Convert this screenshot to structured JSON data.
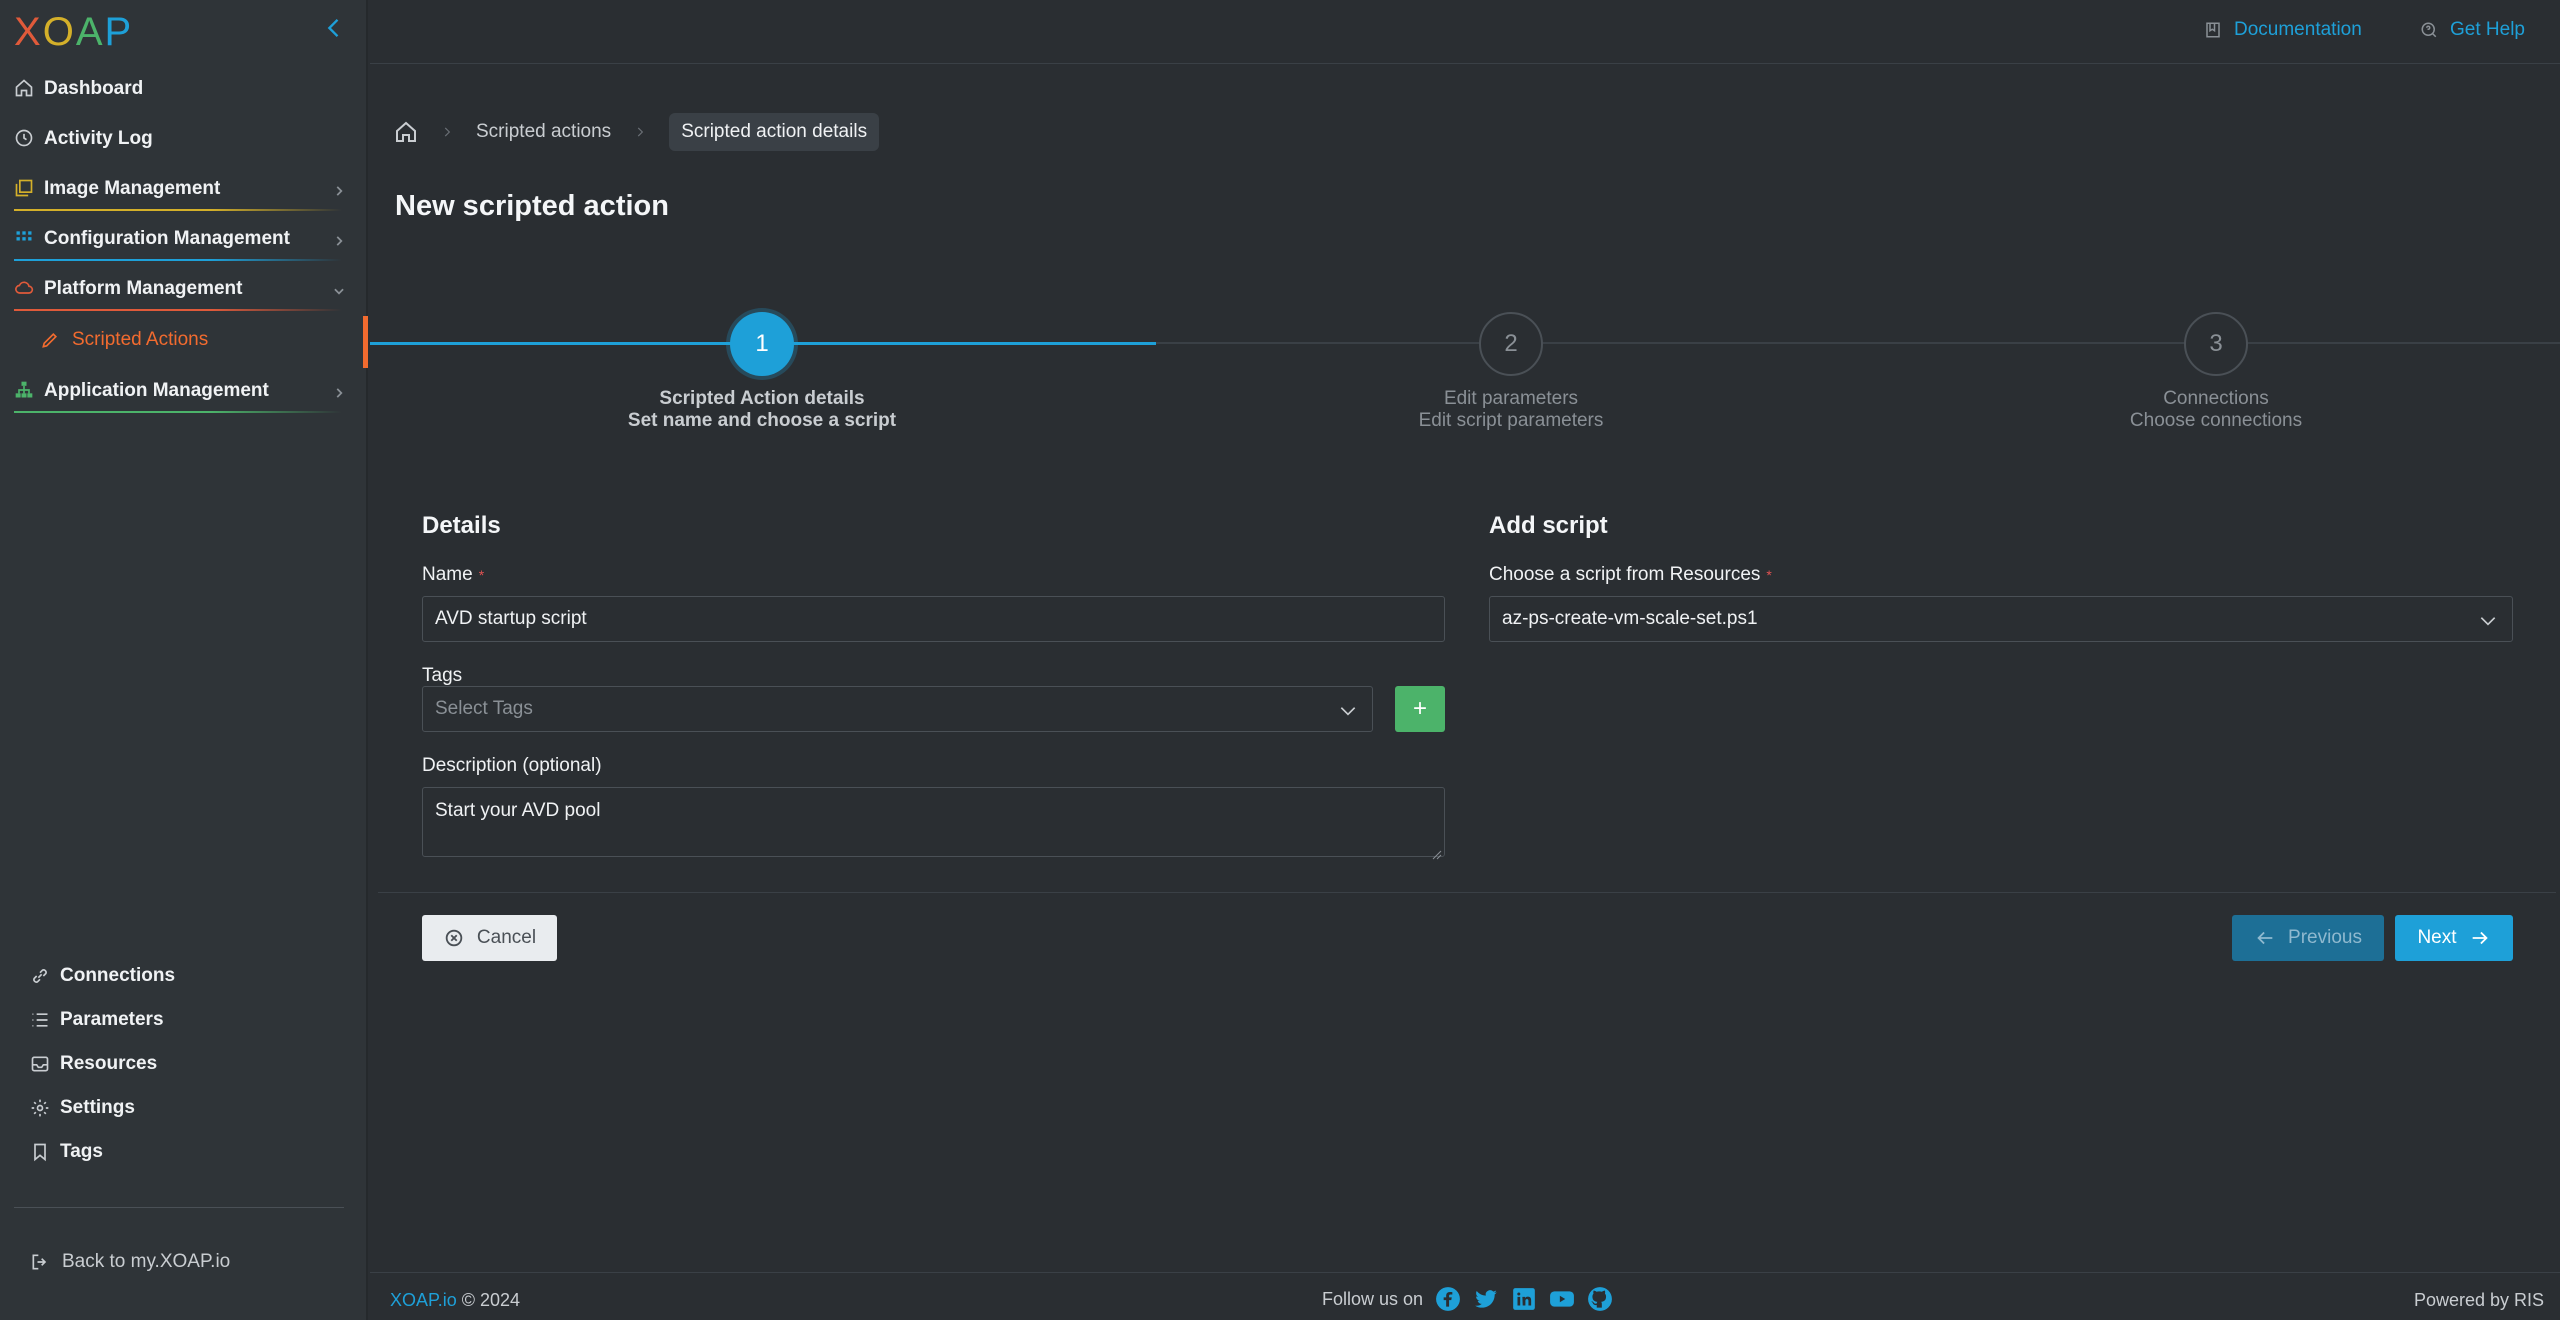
{
  "app": {
    "logo_text": "XOAP",
    "colors": {
      "accent": "#1ea0d8",
      "active_nav": "#f26b2f",
      "add_button": "#4cb36a",
      "background": "#2a2e32",
      "sidebar": "#2f3438"
    }
  },
  "sidebar": {
    "items": [
      {
        "label": "Dashboard",
        "icon": "home-icon"
      },
      {
        "label": "Activity Log",
        "icon": "clock-icon"
      },
      {
        "label": "Image Management",
        "icon": "images-icon",
        "underline": "#d4b02a"
      },
      {
        "label": "Configuration Management",
        "icon": "grid-icon",
        "underline": "#1ea0d8"
      },
      {
        "label": "Platform Management",
        "icon": "cloud-icon",
        "underline": "#e05a3a"
      },
      {
        "label": "Application Management",
        "icon": "sitemap-icon",
        "underline": "#4cb36a"
      }
    ],
    "sub_item": {
      "label": "Scripted Actions",
      "icon": "pencil-icon"
    },
    "bottom_items": [
      {
        "label": "Connections",
        "icon": "link-icon"
      },
      {
        "label": "Parameters",
        "icon": "list-icon"
      },
      {
        "label": "Resources",
        "icon": "inbox-icon"
      },
      {
        "label": "Settings",
        "icon": "gear-icon"
      },
      {
        "label": "Tags",
        "icon": "bookmark-icon"
      }
    ],
    "back_link": "Back to my.XOAP.io"
  },
  "topbar": {
    "documentation": "Documentation",
    "get_help": "Get Help"
  },
  "breadcrumb": {
    "items": [
      "Scripted actions",
      "Scripted action details"
    ]
  },
  "page": {
    "title": "New scripted action"
  },
  "stepper": {
    "steps": [
      {
        "number": "1",
        "title": "Scripted Action details",
        "subtitle": "Set name and choose a script"
      },
      {
        "number": "2",
        "title": "Edit parameters",
        "subtitle": "Edit script parameters"
      },
      {
        "number": "3",
        "title": "Connections",
        "subtitle": "Choose connections"
      }
    ]
  },
  "details": {
    "title": "Details",
    "name_label": "Name",
    "name_value": "AVD startup script",
    "tags_label": "Tags",
    "tags_placeholder": "Select Tags",
    "add_tag": "+",
    "description_label": "Description (optional)",
    "description_value": "Start your AVD pool"
  },
  "add_script": {
    "title": "Add script",
    "choose_label": "Choose a script from Resources",
    "selected_script": "az-ps-create-vm-scale-set.ps1"
  },
  "required_mark": "*",
  "buttons": {
    "cancel": "Cancel",
    "previous": "Previous",
    "next": "Next"
  },
  "footer": {
    "brand": "XOAP.io",
    "copyright": "© 2024",
    "follow": "Follow us on",
    "powered": "Powered by RIS",
    "social": [
      "facebook-icon",
      "twitter-icon",
      "linkedin-icon",
      "youtube-icon",
      "github-icon"
    ]
  }
}
